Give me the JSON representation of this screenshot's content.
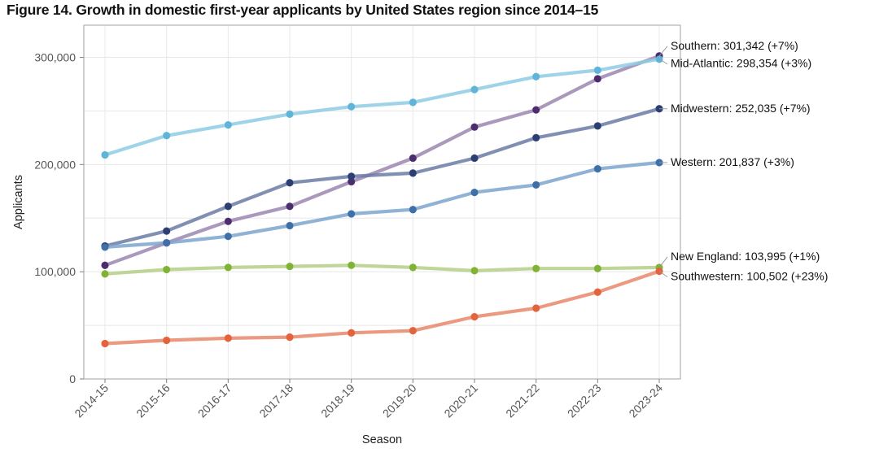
{
  "figure": {
    "title": "Figure 14. Growth in domestic first-year applicants by United States region since 2014–15"
  },
  "chart_data": {
    "type": "line",
    "title": "Figure 14. Growth in domestic first-year applicants by United States region since 2014–15",
    "xlabel": "Season",
    "ylabel": "Applicants",
    "categories": [
      "2014-15",
      "2015-16",
      "2016-17",
      "2017-18",
      "2018-19",
      "2019-20",
      "2020-21",
      "2021-22",
      "2022-23",
      "2023-24"
    ],
    "ylim": [
      0,
      330000
    ],
    "yticks": [
      0,
      100000,
      200000,
      300000
    ],
    "ytick_labels": [
      "0",
      "100,000",
      "200,000",
      "300,000"
    ],
    "grid": true,
    "legend": "right-endpoint-labels",
    "series": [
      {
        "name": "Southern",
        "color": "#9b87b0",
        "end_value": 301342,
        "end_label": "Southern: 301,342 (+7%)",
        "values": [
          106000,
          127000,
          147000,
          161000,
          184000,
          206000,
          235000,
          251000,
          280000,
          301342
        ]
      },
      {
        "name": "Mid-Atlantic",
        "color": "#8ecbe3",
        "end_value": 298354,
        "end_label": "Mid-Atlantic: 298,354 (+3%)",
        "values": [
          209000,
          227000,
          237000,
          247000,
          254000,
          258000,
          270000,
          282000,
          288000,
          298354
        ]
      },
      {
        "name": "Midwestern",
        "color": "#6b7ba6",
        "end_value": 252035,
        "end_label": "Midwestern: 252,035 (+7%)",
        "values": [
          124000,
          138000,
          161000,
          183000,
          189000,
          192000,
          206000,
          225000,
          236000,
          252035
        ]
      },
      {
        "name": "Western",
        "color": "#7da5cc",
        "end_value": 201837,
        "end_label": "Western: 201,837 (+3%)",
        "values": [
          123000,
          127000,
          133000,
          143000,
          154000,
          158000,
          174000,
          181000,
          196000,
          201837
        ]
      },
      {
        "name": "New England",
        "color": "#b5cf86",
        "end_value": 103995,
        "end_label": "New England: 103,995 (+1%)",
        "values": [
          98000,
          102000,
          104000,
          105000,
          106000,
          104000,
          101000,
          103000,
          103000,
          103995
        ]
      },
      {
        "name": "Southwestern",
        "color": "#e8886b",
        "end_value": 100502,
        "end_label": "Southwestern: 100,502 (+23%)",
        "values": [
          33000,
          36000,
          38000,
          39000,
          43000,
          45000,
          58000,
          66000,
          81000,
          100502
        ]
      }
    ]
  }
}
